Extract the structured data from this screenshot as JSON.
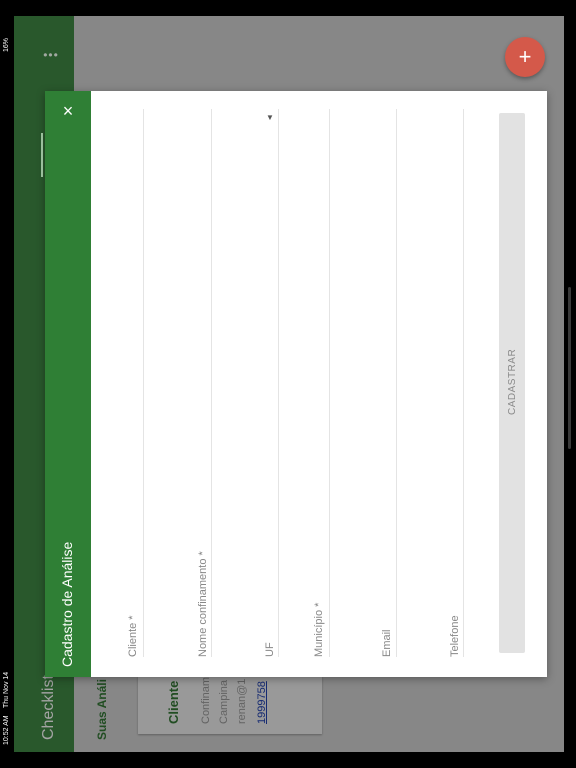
{
  "status_bar": {
    "time": "10:52 AM",
    "date": "Thu Nov 14",
    "battery": "16%"
  },
  "app_bar": {
    "title": "Checklist",
    "more_icon": "more-dots-icon"
  },
  "background_list": {
    "section_title": "Suas Análi",
    "card": {
      "title": "Cliente",
      "line1": "Confinam",
      "line2": "Campina",
      "line3": "renan@1",
      "phone": "1999758"
    }
  },
  "fab": {
    "label": "+",
    "icon": "plus-icon",
    "color": "#d4594a"
  },
  "modal": {
    "title": "Cadastro de Análise",
    "close_icon": "×",
    "header_color": "#2f7f35",
    "fields": [
      {
        "label": "Cliente *"
      },
      {
        "label": "Nome confinamento *"
      },
      {
        "label": "UF"
      },
      {
        "label": "Município *"
      },
      {
        "label": "Email"
      },
      {
        "label": "Telefone"
      }
    ],
    "dropdown_icon": "▼",
    "submit_label": "CADASTRAR"
  }
}
